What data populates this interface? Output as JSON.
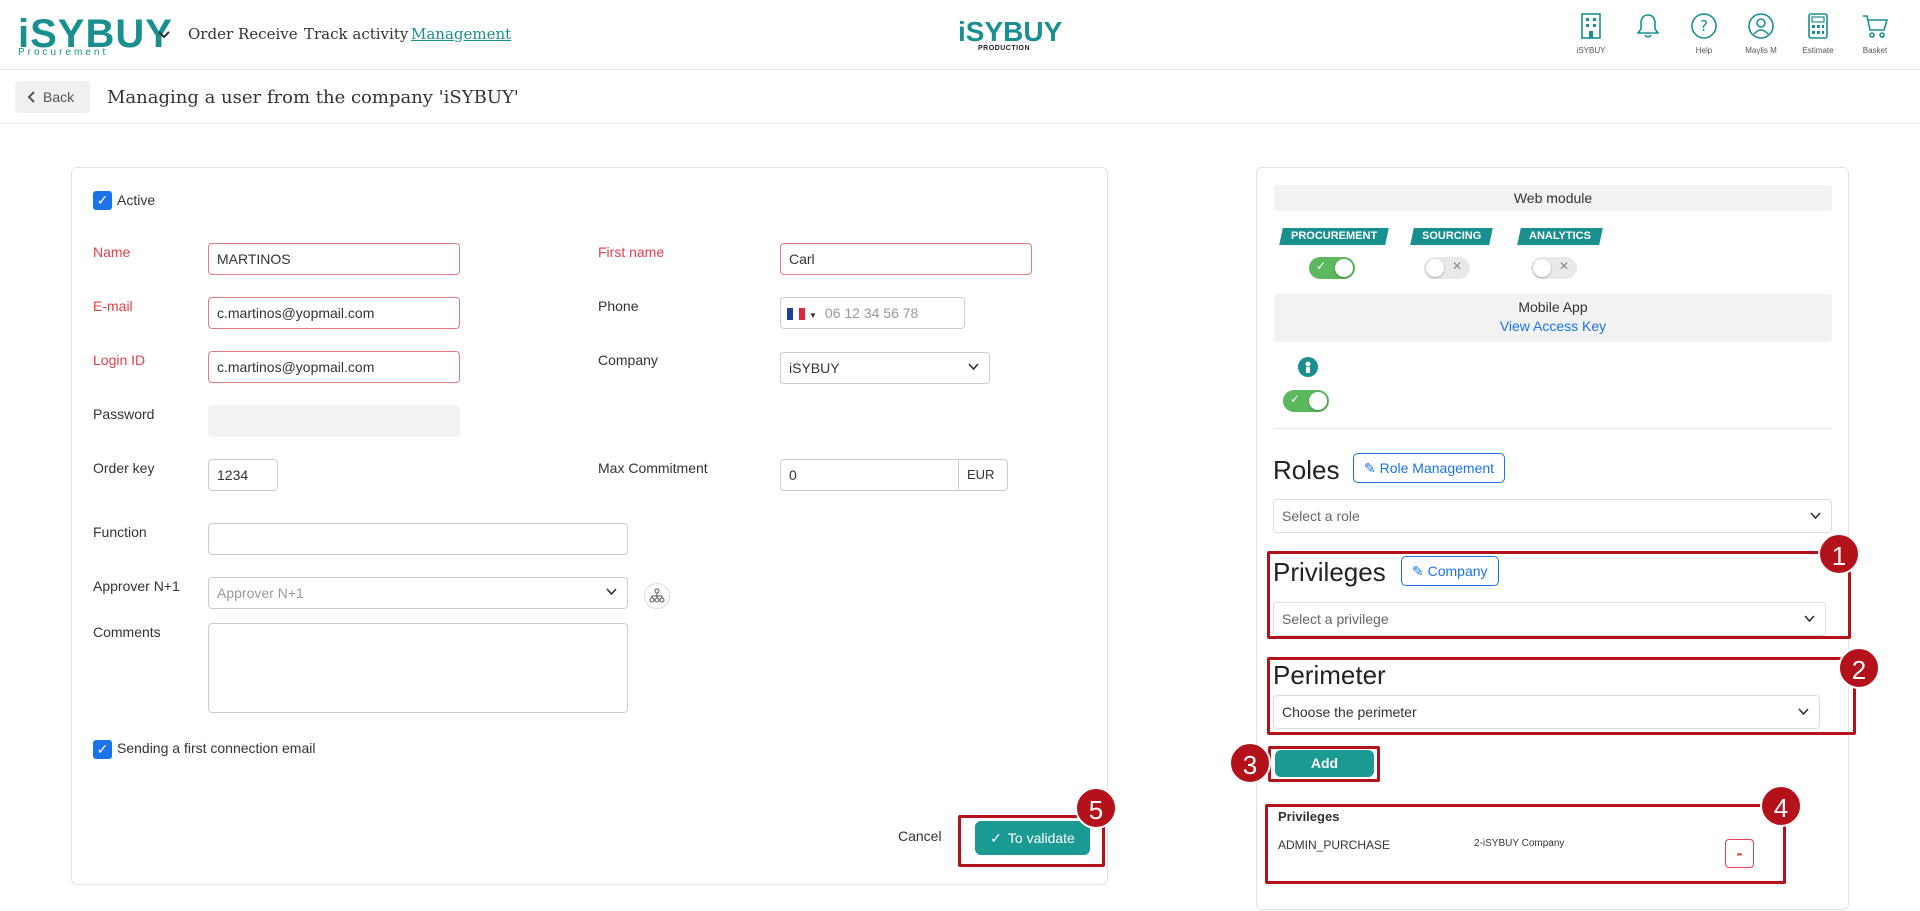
{
  "header": {
    "logo": "iSYBUY",
    "logo_sub": "Procurement",
    "nav": [
      "Order",
      "Receive",
      "Track activity",
      "Management"
    ],
    "center_logo": "iSYBUY",
    "center_sub": "PRODUCTION",
    "icons": [
      {
        "name": "building-icon",
        "label": "iSYBUY"
      },
      {
        "name": "bell-icon",
        "label": ""
      },
      {
        "name": "help-icon",
        "label": "Help"
      },
      {
        "name": "user-icon",
        "label": "Maylis M"
      },
      {
        "name": "calculator-icon",
        "label": "Estimate"
      },
      {
        "name": "cart-icon",
        "label": "Basket"
      }
    ]
  },
  "subheader": {
    "back": "Back",
    "title": "Managing a user from the company 'iSYBUY'"
  },
  "form": {
    "active_label": "Active",
    "name_label": "Name",
    "name_value": "MARTINOS",
    "first_name_label": "First name",
    "first_name_value": "Carl",
    "email_label": "E-mail",
    "email_value": "c.martinos@yopmail.com",
    "phone_label": "Phone",
    "phone_placeholder": "06 12 34 56 78",
    "login_label": "Login ID",
    "login_value": "c.martinos@yopmail.com",
    "company_label": "Company",
    "company_value": "iSYBUY",
    "password_label": "Password",
    "order_key_label": "Order key",
    "order_key_value": "1234",
    "max_commitment_label": "Max Commitment",
    "max_commitment_value": "0",
    "currency": "EUR",
    "function_label": "Function",
    "approver_label": "Approver N+1",
    "approver_placeholder": "Approver N+1",
    "comments_label": "Comments",
    "sending_label": "Sending a first connection email",
    "cancel": "Cancel",
    "validate": "To validate"
  },
  "rights": {
    "web_module": "Web module",
    "modules": [
      {
        "tag": "PROCUREMENT",
        "on": true
      },
      {
        "tag": "SOURCING",
        "on": false
      },
      {
        "tag": "ANALYTICS",
        "on": false
      }
    ],
    "mobile_app": "Mobile App",
    "view_access_key": "View Access Key",
    "roles_title": "Roles",
    "role_management": "Role Management",
    "role_placeholder": "Select a role",
    "privileges_title": "Privileges",
    "company_btn": "Company",
    "privilege_placeholder": "Select a privilege",
    "perimeter_title": "Perimeter",
    "perimeter_placeholder": "Choose the perimeter",
    "add": "Add",
    "table_title": "Privileges",
    "rows": [
      {
        "privilege": "ADMIN_PURCHASE",
        "perimeter": "2-iSYBUY Company",
        "remove": "-"
      }
    ]
  },
  "callouts": [
    "1",
    "2",
    "3",
    "4",
    "5"
  ],
  "colors": {
    "brand": "#1a8f8f",
    "button": "#1a9a92",
    "callout": "#b3121b",
    "required": "#e0414a",
    "link": "#1a73e8"
  }
}
